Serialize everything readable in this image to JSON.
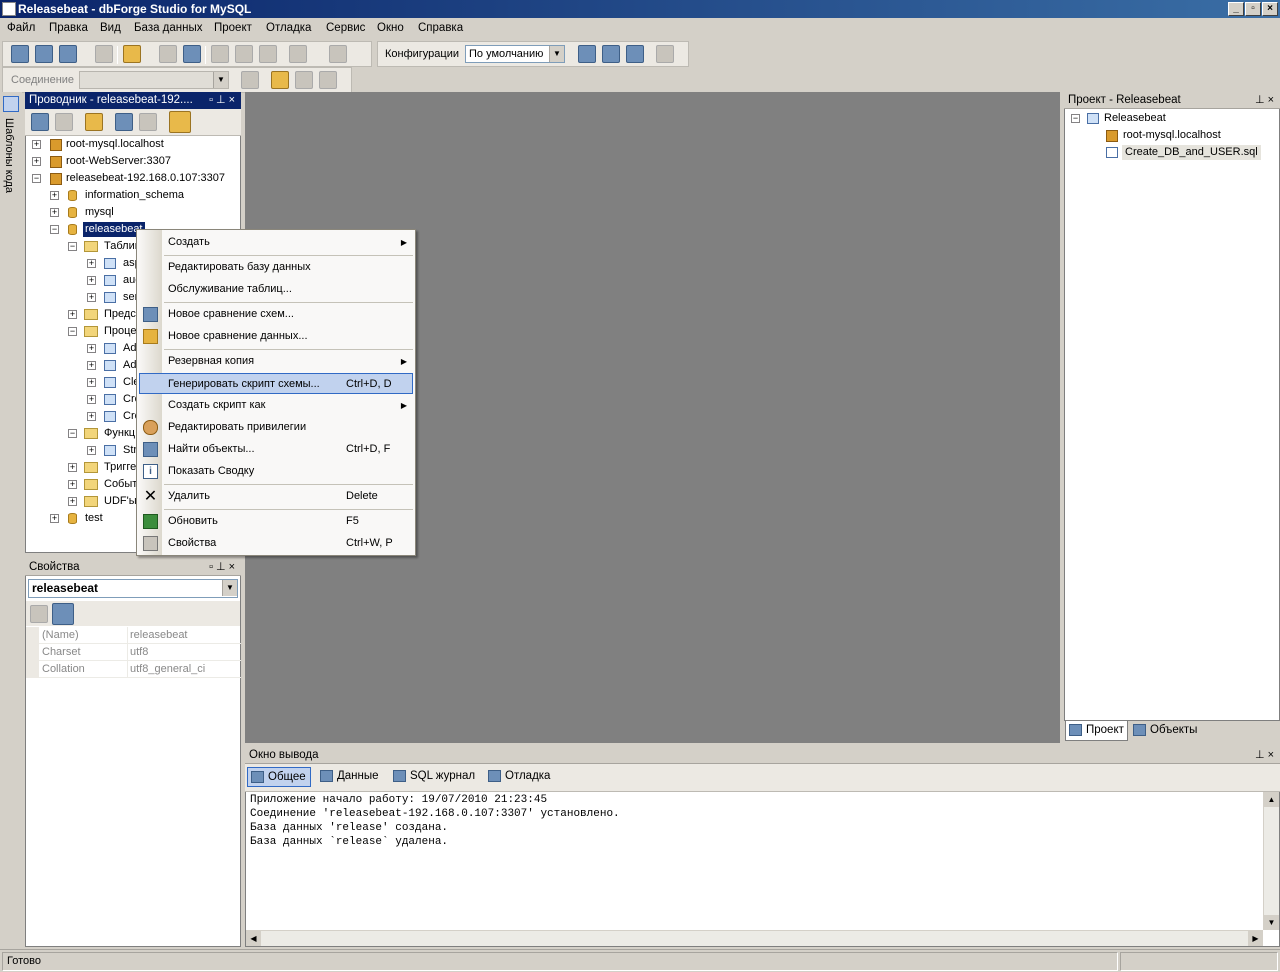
{
  "window": {
    "title": "Releasebeat - dbForge Studio for MySQL"
  },
  "menu": [
    "Файл",
    "Правка",
    "Вид",
    "База данных",
    "Проект",
    "Отладка",
    "Сервис",
    "Окно",
    "Справка"
  ],
  "toolbar": {
    "config_label": "Конфигурации",
    "config_value": "По умолчанию",
    "connection_label": "Соединение",
    "connection_value": ""
  },
  "left_strip": {
    "label": "Шаблоны кода"
  },
  "explorer": {
    "title": "Проводник - releasebeat-192....",
    "nodes": {
      "n0": "root-mysql.localhost",
      "n1": "root-WebServer:3307",
      "n2": "releasebeat-192.168.0.107:3307",
      "n3": "information_schema",
      "n4": "mysql",
      "n5": "releasebeat",
      "n6": "Таблиц",
      "n7": "asp",
      "n8": "auc",
      "n9": "ser",
      "n10": "Предст",
      "n11": "Проце",
      "n12": "Ad",
      "n13": "Ad",
      "n14": "Cle",
      "n15": "Cre",
      "n16": "Cre",
      "n17": "Функц",
      "n18": "Str",
      "n19": "Тригге",
      "n20": "Событ",
      "n21": "UDF'ы",
      "n22": "test"
    }
  },
  "properties": {
    "title": "Свойства",
    "object": "releasebeat",
    "rows": [
      {
        "name": "(Name)",
        "value": "releasebeat"
      },
      {
        "name": "Charset",
        "value": "utf8"
      },
      {
        "name": "Collation",
        "value": "utf8_general_ci"
      }
    ]
  },
  "context_menu": {
    "items": [
      {
        "label": "Создать",
        "shortcut": "",
        "submenu": true
      },
      {
        "label": "Редактировать базу данных",
        "shortcut": ""
      },
      {
        "label": "Обслуживание таблиц...",
        "shortcut": ""
      },
      {
        "label": "Новое сравнение схем...",
        "shortcut": ""
      },
      {
        "label": "Новое сравнение данных...",
        "shortcut": ""
      },
      {
        "label": "Резервная копия",
        "shortcut": "",
        "submenu": true
      },
      {
        "label": "Генерировать скрипт схемы...",
        "shortcut": "Ctrl+D, D",
        "highlighted": true
      },
      {
        "label": "Создать скрипт как",
        "shortcut": "",
        "submenu": true
      },
      {
        "label": "Редактировать привилегии",
        "shortcut": ""
      },
      {
        "label": "Найти объекты...",
        "shortcut": "Ctrl+D, F"
      },
      {
        "label": "Показать Сводку",
        "shortcut": ""
      },
      {
        "label": "Удалить",
        "shortcut": "Delete"
      },
      {
        "label": "Обновить",
        "shortcut": "F5"
      },
      {
        "label": "Свойства",
        "shortcut": "Ctrl+W, P"
      }
    ]
  },
  "project": {
    "title": "Проект - Releasebeat",
    "root": "Releasebeat",
    "items": [
      "root-mysql.localhost",
      "Create_DB_and_USER.sql"
    ],
    "tabs": [
      "Проект",
      "Объекты"
    ]
  },
  "output": {
    "title": "Окно вывода",
    "tabs": [
      "Общее",
      "Данные",
      "SQL журнал",
      "Отладка"
    ],
    "lines": [
      "Приложение начало работу: 19/07/2010 21:23:45",
      "Соединение 'releasebeat-192.168.0.107:3307' установлено.",
      "База данных 'release' создана.",
      "База данных `release` удалена."
    ]
  },
  "status": {
    "text": "Готово"
  }
}
